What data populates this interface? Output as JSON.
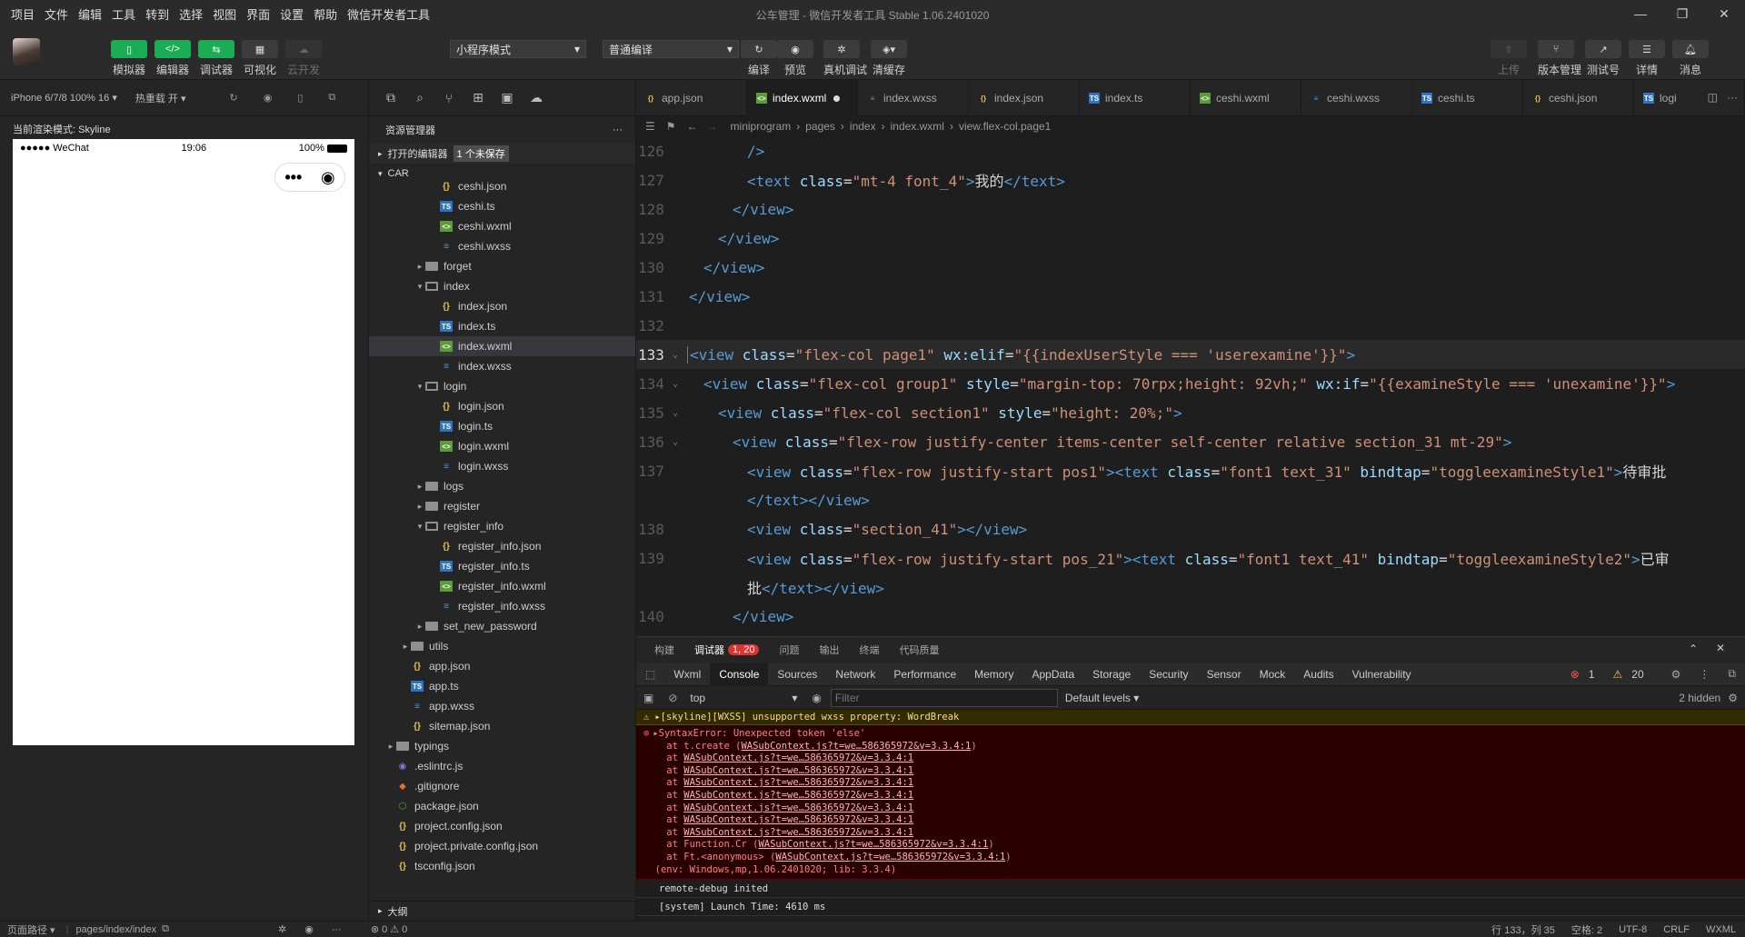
{
  "menu": [
    "项目",
    "文件",
    "编辑",
    "工具",
    "转到",
    "选择",
    "视图",
    "界面",
    "设置",
    "帮助",
    "微信开发者工具"
  ],
  "window_title": "公车管理 - 微信开发者工具 Stable 1.06.2401020",
  "toolbar": {
    "left_buttons": [
      "模拟器",
      "编辑器",
      "调试器",
      "可视化",
      "云开发"
    ],
    "mode_select": "小程序模式",
    "compile_select": "普通编译",
    "mid_buttons": [
      "编译",
      "预览",
      "真机调试",
      "清缓存"
    ],
    "right_buttons": [
      "上传",
      "版本管理",
      "测试号",
      "详情",
      "消息"
    ]
  },
  "simulator": {
    "device": "iPhone 6/7/8 100% 16",
    "hot_reload": "热重载 开",
    "render_mode": "当前渲染模式: Skyline",
    "status_carrier": "●●●●● WeChat",
    "status_time": "19:06",
    "status_battery": "100%",
    "capsule_menu": "•••",
    "capsule_close": "◉"
  },
  "explorer": {
    "header": "资源管理器",
    "more": "···",
    "open_editors": "打开的编辑器",
    "unsaved_badge": "1 个未保存",
    "root": "CAR",
    "outline": "大纲",
    "items": [
      {
        "name": "ceshi.json",
        "type": "json",
        "depth": 3
      },
      {
        "name": "ceshi.ts",
        "type": "ts",
        "depth": 3
      },
      {
        "name": "ceshi.wxml",
        "type": "wxml",
        "depth": 3
      },
      {
        "name": "ceshi.wxss",
        "type": "wxss",
        "depth": 3
      },
      {
        "name": "forget",
        "type": "folder",
        "depth": 2,
        "arrow": "▸"
      },
      {
        "name": "index",
        "type": "folder-open",
        "depth": 2,
        "arrow": "▾"
      },
      {
        "name": "index.json",
        "type": "json",
        "depth": 3
      },
      {
        "name": "index.ts",
        "type": "ts",
        "depth": 3
      },
      {
        "name": "index.wxml",
        "type": "wxml",
        "depth": 3,
        "selected": true
      },
      {
        "name": "index.wxss",
        "type": "wxss",
        "depth": 3
      },
      {
        "name": "login",
        "type": "folder-open",
        "depth": 2,
        "arrow": "▾"
      },
      {
        "name": "login.json",
        "type": "json",
        "depth": 3
      },
      {
        "name": "login.ts",
        "type": "ts",
        "depth": 3
      },
      {
        "name": "login.wxml",
        "type": "wxml",
        "depth": 3
      },
      {
        "name": "login.wxss",
        "type": "wxss",
        "depth": 3
      },
      {
        "name": "logs",
        "type": "folder",
        "depth": 2,
        "arrow": "▸"
      },
      {
        "name": "register",
        "type": "folder",
        "depth": 2,
        "arrow": "▸"
      },
      {
        "name": "register_info",
        "type": "folder-open",
        "depth": 2,
        "arrow": "▾"
      },
      {
        "name": "register_info.json",
        "type": "json",
        "depth": 3
      },
      {
        "name": "register_info.ts",
        "type": "ts",
        "depth": 3
      },
      {
        "name": "register_info.wxml",
        "type": "wxml",
        "depth": 3
      },
      {
        "name": "register_info.wxss",
        "type": "wxss",
        "depth": 3
      },
      {
        "name": "set_new_password",
        "type": "folder",
        "depth": 2,
        "arrow": "▸"
      },
      {
        "name": "utils",
        "type": "folder",
        "depth": 1,
        "arrow": "▸"
      },
      {
        "name": "app.json",
        "type": "json",
        "depth": 1
      },
      {
        "name": "app.ts",
        "type": "ts",
        "depth": 1
      },
      {
        "name": "app.wxss",
        "type": "wxss",
        "depth": 1
      },
      {
        "name": "sitemap.json",
        "type": "json",
        "depth": 1
      },
      {
        "name": "typings",
        "type": "folder",
        "depth": 0,
        "arrow": "▸"
      },
      {
        "name": ".eslintrc.js",
        "type": "lint",
        "depth": 0
      },
      {
        "name": ".gitignore",
        "type": "git",
        "depth": 0
      },
      {
        "name": "package.json",
        "type": "pkg",
        "depth": 0
      },
      {
        "name": "project.config.json",
        "type": "json",
        "depth": 0
      },
      {
        "name": "project.private.config.json",
        "type": "json",
        "depth": 0
      },
      {
        "name": "tsconfig.json",
        "type": "json",
        "depth": 0
      }
    ]
  },
  "editor": {
    "tabs": [
      {
        "name": "app.json",
        "type": "json"
      },
      {
        "name": "index.wxml",
        "type": "wxml",
        "active": true,
        "dirty": true
      },
      {
        "name": "index.wxss",
        "type": "wxss"
      },
      {
        "name": "index.json",
        "type": "json"
      },
      {
        "name": "index.ts",
        "type": "ts"
      },
      {
        "name": "ceshi.wxml",
        "type": "wxml"
      },
      {
        "name": "ceshi.wxss",
        "type": "wxss"
      },
      {
        "name": "ceshi.ts",
        "type": "ts"
      },
      {
        "name": "ceshi.json",
        "type": "json"
      },
      {
        "name": "logi",
        "type": "ts"
      }
    ],
    "breadcrumb": [
      "miniprogram",
      "pages",
      "index",
      "index.wxml",
      "view.flex-col.page1"
    ],
    "lines": [
      {
        "n": "126",
        "indent": 4,
        "parts": [
          [
            "tg",
            "/>"
          ]
        ]
      },
      {
        "n": "127",
        "indent": 4,
        "parts": [
          [
            "tg",
            "<text "
          ],
          [
            "at",
            "class"
          ],
          [
            "tx",
            "="
          ],
          [
            "st",
            "\"mt-4 font_4\""
          ],
          [
            "tg",
            ">"
          ],
          [
            "tx",
            "我的"
          ],
          [
            "tg",
            "</text>"
          ]
        ]
      },
      {
        "n": "128",
        "indent": 3,
        "parts": [
          [
            "tg",
            "</view>"
          ]
        ]
      },
      {
        "n": "129",
        "indent": 2,
        "parts": [
          [
            "tg",
            "</view>"
          ]
        ]
      },
      {
        "n": "130",
        "indent": 1,
        "parts": [
          [
            "tg",
            "</view>"
          ]
        ]
      },
      {
        "n": "131",
        "indent": 0,
        "parts": [
          [
            "tg",
            "</view>"
          ]
        ]
      },
      {
        "n": "132",
        "indent": 0,
        "parts": []
      },
      {
        "n": "133",
        "indent": 0,
        "cur": true,
        "fold": "⌄",
        "parts": [
          [
            "tg",
            "<view "
          ],
          [
            "at",
            "class"
          ],
          [
            "tx",
            "="
          ],
          [
            "st",
            "\"flex-col page1\""
          ],
          [
            "tx",
            " "
          ],
          [
            "at",
            "wx:elif"
          ],
          [
            "tx",
            "="
          ],
          [
            "st",
            "\"{{indexUserStyle === 'userexamine'}}\""
          ],
          [
            "tg",
            ">"
          ]
        ]
      },
      {
        "n": "134",
        "indent": 1,
        "fold": "⌄",
        "parts": [
          [
            "tg",
            "<view "
          ],
          [
            "at",
            "class"
          ],
          [
            "tx",
            "="
          ],
          [
            "st",
            "\"flex-col group1\""
          ],
          [
            "tx",
            " "
          ],
          [
            "at",
            "style"
          ],
          [
            "tx",
            "="
          ],
          [
            "st",
            "\"margin-top: 70rpx;height: 92vh;\""
          ],
          [
            "tx",
            " "
          ],
          [
            "at",
            "wx:if"
          ],
          [
            "tx",
            "="
          ],
          [
            "st",
            "\"{{examineStyle === 'unexamine'}}\""
          ],
          [
            "tg",
            ">"
          ]
        ]
      },
      {
        "n": "135",
        "indent": 2,
        "fold": "⌄",
        "parts": [
          [
            "tg",
            "<view "
          ],
          [
            "at",
            "class"
          ],
          [
            "tx",
            "="
          ],
          [
            "st",
            "\"flex-col section1\""
          ],
          [
            "tx",
            " "
          ],
          [
            "at",
            "style"
          ],
          [
            "tx",
            "="
          ],
          [
            "st",
            "\"height: 20%;\""
          ],
          [
            "tg",
            ">"
          ]
        ]
      },
      {
        "n": "136",
        "indent": 3,
        "fold": "⌄",
        "parts": [
          [
            "tg",
            "<view "
          ],
          [
            "at",
            "class"
          ],
          [
            "tx",
            "="
          ],
          [
            "st",
            "\"flex-row justify-center items-center self-center relative section_31 mt-29\""
          ],
          [
            "tg",
            ">"
          ]
        ]
      },
      {
        "n": "137",
        "indent": 4,
        "parts": [
          [
            "tg",
            "<view "
          ],
          [
            "at",
            "class"
          ],
          [
            "tx",
            "="
          ],
          [
            "st",
            "\"flex-row justify-start pos1\""
          ],
          [
            "tg",
            "><text "
          ],
          [
            "at",
            "class"
          ],
          [
            "tx",
            "="
          ],
          [
            "st",
            "\"font1 text_31\""
          ],
          [
            "tx",
            " "
          ],
          [
            "at",
            "bindtap"
          ],
          [
            "tx",
            "="
          ],
          [
            "st",
            "\"toggleexamineStyle1\""
          ],
          [
            "tg",
            ">"
          ],
          [
            "tx",
            "待审批"
          ]
        ]
      },
      {
        "n": "",
        "indent": 4,
        "parts": [
          [
            "tg",
            "</text></view>"
          ]
        ]
      },
      {
        "n": "138",
        "indent": 4,
        "parts": [
          [
            "tg",
            "<view "
          ],
          [
            "at",
            "class"
          ],
          [
            "tx",
            "="
          ],
          [
            "st",
            "\"section_41\""
          ],
          [
            "tg",
            "></view>"
          ]
        ]
      },
      {
        "n": "139",
        "indent": 4,
        "parts": [
          [
            "tg",
            "<view "
          ],
          [
            "at",
            "class"
          ],
          [
            "tx",
            "="
          ],
          [
            "st",
            "\"flex-row justify-start pos_21\""
          ],
          [
            "tg",
            "><text "
          ],
          [
            "at",
            "class"
          ],
          [
            "tx",
            "="
          ],
          [
            "st",
            "\"font1 text_41\""
          ],
          [
            "tx",
            " "
          ],
          [
            "at",
            "bindtap"
          ],
          [
            "tx",
            "="
          ],
          [
            "st",
            "\"toggleexamineStyle2\""
          ],
          [
            "tg",
            ">"
          ],
          [
            "tx",
            "已审"
          ]
        ]
      },
      {
        "n": "",
        "indent": 4,
        "parts": [
          [
            "tx",
            "批"
          ],
          [
            "tg",
            "</text></view>"
          ]
        ]
      },
      {
        "n": "140",
        "indent": 3,
        "parts": [
          [
            "tg",
            "</view>"
          ]
        ]
      }
    ]
  },
  "panel": {
    "tabs": [
      "构建",
      "调试器",
      "问题",
      "输出",
      "终端",
      "代码质量"
    ],
    "active_tab": "调试器",
    "debugger_badge": "1, 20",
    "devtools_tabs": [
      "Wxml",
      "Console",
      "Sources",
      "Network",
      "Performance",
      "Memory",
      "AppData",
      "Storage",
      "Security",
      "Sensor",
      "Mock",
      "Audits",
      "Vulnerability"
    ],
    "active_devtool": "Console",
    "error_count": "1",
    "warn_count": "20",
    "context": "top",
    "filter_placeholder": "Filter",
    "levels": "Default levels ▾",
    "hidden": "2 hidden",
    "warning_line": "▸[skyline][WXSS] unsupported wxss property: WordBreak",
    "error_head": "▸SyntaxError: Unexpected token 'else'",
    "error_stack": [
      [
        "    at t.create (",
        "WASubContext.js?t=we…586365972&v=3.3.4:1",
        ")"
      ],
      [
        "    at ",
        "WASubContext.js?t=we…586365972&v=3.3.4:1",
        ""
      ],
      [
        "    at ",
        "WASubContext.js?t=we…586365972&v=3.3.4:1",
        ""
      ],
      [
        "    at ",
        "WASubContext.js?t=we…586365972&v=3.3.4:1",
        ""
      ],
      [
        "    at ",
        "WASubContext.js?t=we…586365972&v=3.3.4:1",
        ""
      ],
      [
        "    at ",
        "WASubContext.js?t=we…586365972&v=3.3.4:1",
        ""
      ],
      [
        "    at ",
        "WASubContext.js?t=we…586365972&v=3.3.4:1",
        ""
      ],
      [
        "    at ",
        "WASubContext.js?t=we…586365972&v=3.3.4:1",
        ""
      ],
      [
        "    at Function.Cr (",
        "WASubContext.js?t=we…586365972&v=3.3.4:1",
        ")"
      ],
      [
        "    at Ft.<anonymous> (",
        "WASubContext.js?t=we…586365972&v=3.3.4:1",
        ")"
      ],
      [
        "  (env: Windows,mp,1.06.2401020; lib: 3.3.4)",
        "",
        ""
      ]
    ],
    "log_lines": [
      "remote-debug inited",
      "[system] Launch Time: 4610 ms"
    ]
  },
  "statusbar": {
    "page_path_label": "页面路径 ▾",
    "page_path": "pages/index/index",
    "problems": "⊗ 0 ⚠ 0",
    "position": "行 133，列 35",
    "spaces": "空格: 2",
    "encoding": "UTF-8",
    "eol": "CRLF",
    "language": "WXML"
  }
}
